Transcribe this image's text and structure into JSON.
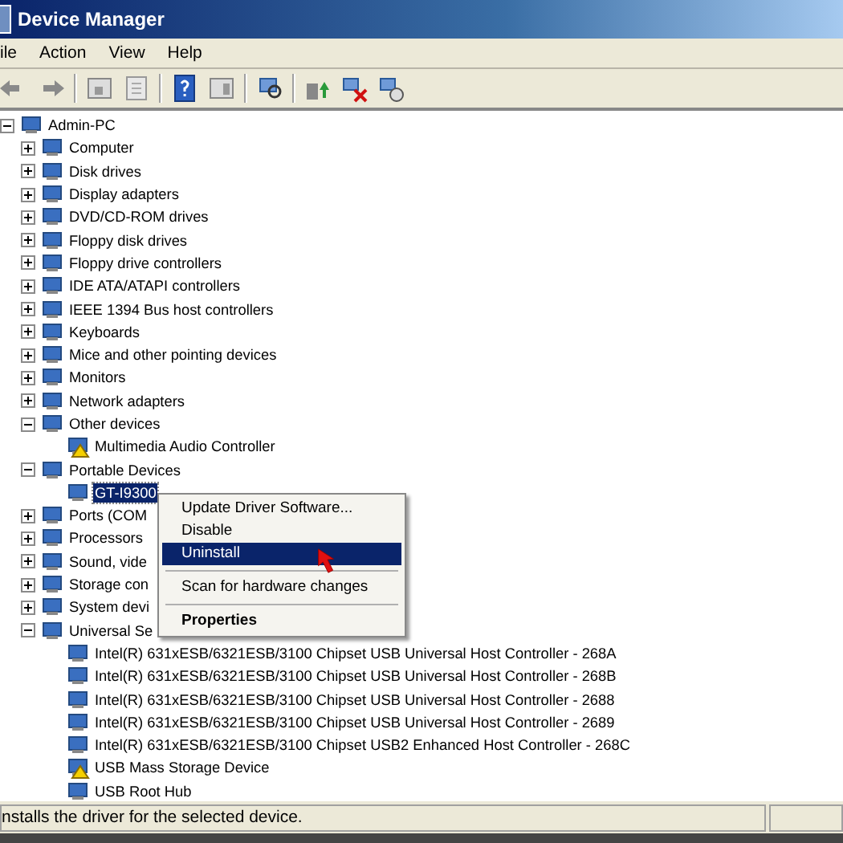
{
  "window": {
    "title": "Device Manager"
  },
  "menu": [
    "ile",
    "Action",
    "View",
    "Help"
  ],
  "tree": {
    "label": "Admin-PC",
    "expanded": true,
    "selected": false,
    "children": [
      {
        "label": "Computer",
        "expanded": false,
        "selected": false
      },
      {
        "label": "Disk drives",
        "expanded": false,
        "selected": false
      },
      {
        "label": "Display adapters",
        "expanded": false,
        "selected": false
      },
      {
        "label": "DVD/CD-ROM drives",
        "expanded": false,
        "selected": false
      },
      {
        "label": "Floppy disk drives",
        "expanded": false,
        "selected": false
      },
      {
        "label": "Floppy drive controllers",
        "expanded": false,
        "selected": false
      },
      {
        "label": "IDE ATA/ATAPI controllers",
        "expanded": false,
        "selected": false
      },
      {
        "label": "IEEE 1394 Bus host controllers",
        "expanded": false,
        "selected": false
      },
      {
        "label": "Keyboards",
        "expanded": false,
        "selected": false
      },
      {
        "label": "Mice and other pointing devices",
        "expanded": false,
        "selected": false
      },
      {
        "label": "Monitors",
        "expanded": false,
        "selected": false
      },
      {
        "label": "Network adapters",
        "expanded": false,
        "selected": false
      },
      {
        "label": "Other devices",
        "expanded": true,
        "selected": false,
        "children": [
          {
            "label": "Multimedia Audio Controller",
            "selected": false,
            "warning": true
          }
        ]
      },
      {
        "label": "Portable Devices",
        "expanded": true,
        "selected": false,
        "children": [
          {
            "label": "GT-I9300",
            "selected": true,
            "warning": false
          }
        ]
      },
      {
        "label": "Ports (COM",
        "expanded": false,
        "selected": false
      },
      {
        "label": "Processors",
        "expanded": false,
        "selected": false
      },
      {
        "label": "Sound, vide",
        "expanded": false,
        "selected": false
      },
      {
        "label": "Storage con",
        "expanded": false,
        "selected": false
      },
      {
        "label": "System devi",
        "expanded": false,
        "selected": false
      },
      {
        "label": "Universal Se",
        "expanded": true,
        "selected": false,
        "children": [
          {
            "label": "Intel(R) 631xESB/6321ESB/3100 Chipset USB Universal Host Controller - 268A",
            "selected": false,
            "warning": false
          },
          {
            "label": "Intel(R) 631xESB/6321ESB/3100 Chipset USB Universal Host Controller - 268B",
            "selected": false,
            "warning": false
          },
          {
            "label": "Intel(R) 631xESB/6321ESB/3100 Chipset USB Universal Host Controller - 2688",
            "selected": false,
            "warning": false
          },
          {
            "label": "Intel(R) 631xESB/6321ESB/3100 Chipset USB Universal Host Controller - 2689",
            "selected": false,
            "warning": false
          },
          {
            "label": "Intel(R) 631xESB/6321ESB/3100 Chipset USB2 Enhanced Host Controller - 268C",
            "selected": false,
            "warning": false
          },
          {
            "label": "USB Mass Storage Device",
            "selected": false,
            "warning": true
          },
          {
            "label": "USB Root Hub",
            "selected": false,
            "warning": false
          }
        ]
      }
    ]
  },
  "context_menu": [
    {
      "kind": "item",
      "label": "Update Driver Software...",
      "selected": false
    },
    {
      "kind": "item",
      "label": "Disable",
      "selected": false
    },
    {
      "kind": "item",
      "label": "Uninstall",
      "selected": true
    },
    {
      "kind": "separator"
    },
    {
      "kind": "item",
      "label": "Scan for hardware changes",
      "selected": false
    },
    {
      "kind": "separator"
    },
    {
      "kind": "default",
      "label": "Properties",
      "selected": false
    }
  ],
  "status_bar": {
    "text": "nstalls the driver for the selected device."
  }
}
